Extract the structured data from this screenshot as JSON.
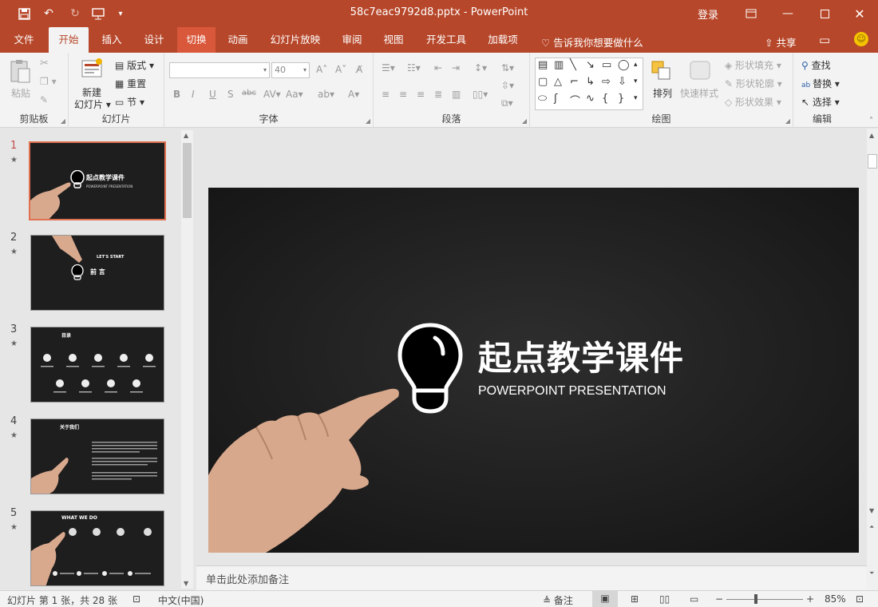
{
  "titlebar": {
    "title": "58c7eac9792d8.pptx  -  PowerPoint",
    "login": "登录"
  },
  "tabs": [
    "文件",
    "开始",
    "插入",
    "设计",
    "切换",
    "动画",
    "幻灯片放映",
    "审阅",
    "视图",
    "开发工具",
    "加载项"
  ],
  "tellme": "告诉我你想要做什么",
  "share": "共享",
  "ribbon": {
    "clipboard": {
      "paste": "粘贴",
      "label": "剪贴板"
    },
    "slides": {
      "new_line1": "新建",
      "new_line2": "幻灯片",
      "layout": "版式",
      "reset": "重置",
      "section": "节",
      "label": "幻灯片"
    },
    "font": {
      "size": "40",
      "label": "字体"
    },
    "paragraph": {
      "label": "段落"
    },
    "drawing": {
      "arrange": "排列",
      "quickstyle": "快速样式",
      "fill": "形状填充",
      "outline": "形状轮廓",
      "effect": "形状效果",
      "label": "绘图"
    },
    "editing": {
      "find": "查找",
      "replace": "替换",
      "select": "选择",
      "label": "编辑"
    }
  },
  "thumbnails": [
    {
      "num": "1",
      "title": "起点教学课件",
      "sub": "POWERPOINT PRESENTATION"
    },
    {
      "num": "2",
      "title": "前 言",
      "sub": "LET'S START"
    },
    {
      "num": "3",
      "title": "目录",
      "sub": ""
    },
    {
      "num": "4",
      "title": "关于我们",
      "sub": ""
    },
    {
      "num": "5",
      "title": "WHAT WE DO",
      "sub": ""
    }
  ],
  "slide": {
    "title": "起点教学课件",
    "subtitle": "POWERPOINT PRESENTATION"
  },
  "notes_placeholder": "单击此处添加备注",
  "status": {
    "slide_info": "幻灯片 第 1 张，共 28 张",
    "language": "中文(中国)",
    "notes": "备注",
    "zoom": "85%"
  },
  "colors": {
    "accent": "#b7472a",
    "slide_bg": "#222222"
  }
}
